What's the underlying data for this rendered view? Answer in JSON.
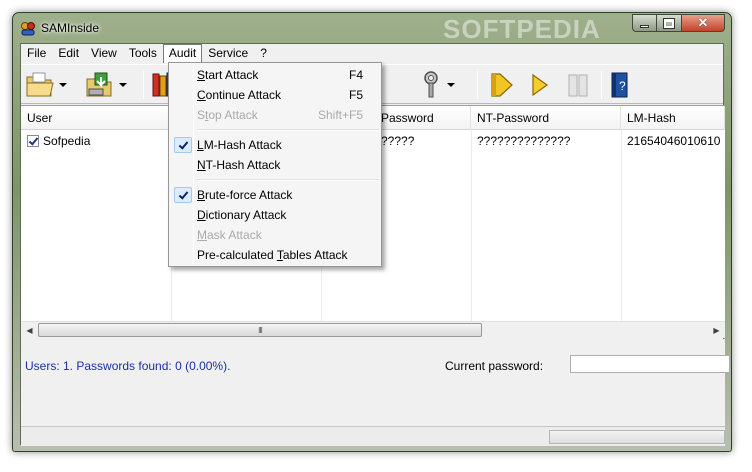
{
  "window": {
    "title": "SAMInside",
    "watermark": "SOFTPEDIA"
  },
  "menubar": [
    {
      "label": "File"
    },
    {
      "label": "Edit"
    },
    {
      "label": "View"
    },
    {
      "label": "Tools"
    },
    {
      "label": "Audit"
    },
    {
      "label": "Service"
    },
    {
      "label": "?"
    }
  ],
  "toolbar": {
    "icons": [
      "open-folder-icon",
      "import-icon",
      "dictionaries-icon",
      "key-icon",
      "start-icon",
      "continue-icon",
      "stop-icon",
      "help-book-icon"
    ]
  },
  "list": {
    "columns": [
      "User",
      "",
      "Password",
      "NT-Password",
      "LM-Hash"
    ],
    "rows": [
      {
        "user": "Sofpedia",
        "checked": true,
        "lm_password_partial": "?????",
        "nt_password": "??????????????",
        "lm_hash": "21654046010610"
      }
    ]
  },
  "audit_menu": {
    "items": [
      {
        "pre": "",
        "ul": "S",
        "post": "tart Attack",
        "key": "F4",
        "disabled": false,
        "checked": false
      },
      {
        "pre": "",
        "ul": "C",
        "post": "ontinue Attack",
        "key": "F5",
        "disabled": false,
        "checked": false
      },
      {
        "pre": "S",
        "ul": "t",
        "post": "op Attack",
        "key": "Shift+F5",
        "disabled": true,
        "checked": false
      },
      {
        "pre": "",
        "ul": "L",
        "post": "M-Hash Attack",
        "key": "",
        "disabled": false,
        "checked": true
      },
      {
        "pre": "",
        "ul": "N",
        "post": "T-Hash Attack",
        "key": "",
        "disabled": false,
        "checked": false
      },
      {
        "pre": "",
        "ul": "B",
        "post": "rute-force Attack",
        "key": "",
        "disabled": false,
        "checked": true
      },
      {
        "pre": "",
        "ul": "D",
        "post": "ictionary Attack",
        "key": "",
        "disabled": false,
        "checked": false
      },
      {
        "pre": "",
        "ul": "M",
        "post": "ask Attack",
        "key": "",
        "disabled": true,
        "checked": false
      },
      {
        "pre": "Pre-calculated ",
        "ul": "T",
        "post": "ables Attack",
        "key": "",
        "disabled": false,
        "checked": false
      }
    ]
  },
  "status": {
    "summary": "Users: 1. Passwords found: 0 (0.00%).",
    "current_password_label": "Current password:",
    "current_password_value": ""
  },
  "scrollbar": {
    "grip": "III"
  },
  "colors": {
    "status_text": "#1b2fa8",
    "menu_check_bg": "#dcecfc"
  }
}
